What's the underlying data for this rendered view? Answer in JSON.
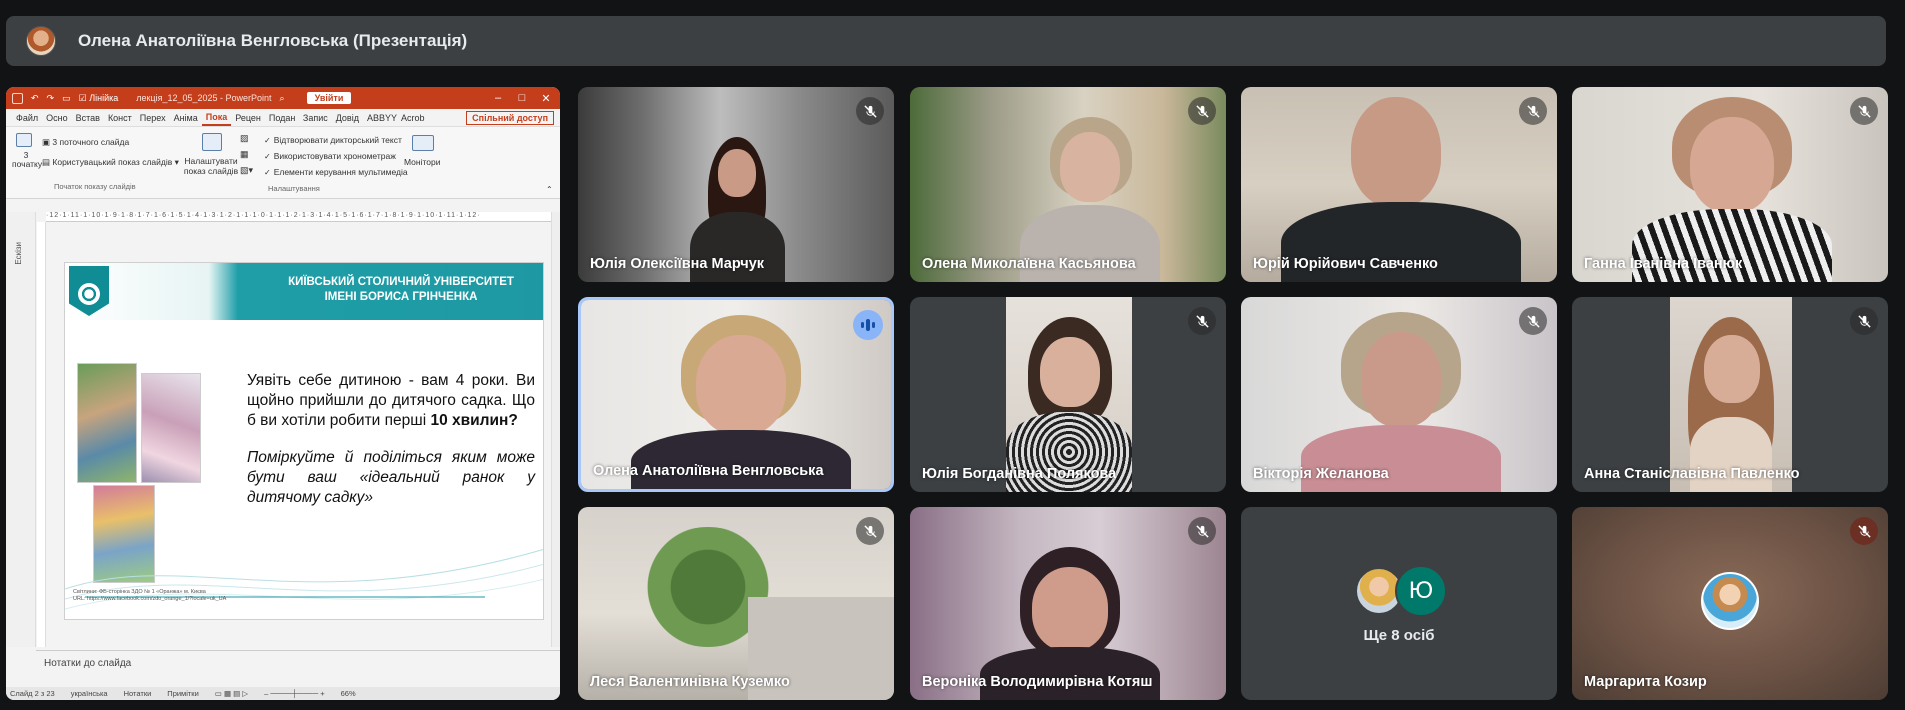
{
  "header": {
    "title": "Олена Анатоліївна Венгловська (Презентація)"
  },
  "ppt": {
    "ruler_label": "Лінійка",
    "doc_title": "лекція_12_05_2025  -  PowerPoint",
    "login": "Увійти",
    "tabs": [
      "Файл",
      "Осно",
      "Встав",
      "Конст",
      "Перех",
      "Аніма",
      "Пока",
      "Рецен",
      "Подан",
      "Запис",
      "Довід",
      "ABBYY",
      "Acrob"
    ],
    "active_tab": "Пока",
    "share": "Спільний доступ",
    "ribbon": {
      "from_start": "3 початку",
      "from_current": "3 поточного слайда",
      "custom_show": "Користувацький показ слайдів",
      "group1": "Початок показу слайдів",
      "setup": "Налаштувати показ слайдів",
      "opt1": "Відтворювати дикторський текст",
      "opt2": "Використовувати хронометраж",
      "opt3": "Елементи керування мультимедіа",
      "group2": "Налаштування",
      "monitors": "Монітори"
    },
    "left_pane": "Ескізи",
    "ruler_ticks": "·12·1·11·1·10·1·9·1·8·1·7·1·6·1·5·1·4·1·3·1·2·1·1·1·0·1·1·1·2·1·3·1·4·1·5·1·6·1·7·1·8·1·9·1·10·1·11·1·12·",
    "slide": {
      "university_line1": "КИЇВСЬКИЙ СТОЛИЧНИЙ УНІВЕРСИТЕТ",
      "university_line2": "ІМЕНІ БОРИСА ГРІНЧЕНКА",
      "text_a": "Уявіть себе дитиною - вам 4 роки. Ви щойно прийшли до дитячого садка. Що б ви хотіли робити перші ",
      "text_bold": "10 хвилин?",
      "text_italic": "Поміркуйте й поділіться яким може бути ваш «ідеальний ранок у дитячому садку»",
      "credit_line1": "Світлини: ФБ-сторінка ЗДО № 1 «Оранжа» м. Києва",
      "credit_line2": "URL: https://www.facebook.com/zdo_orange_1/?locale=uk_UA"
    },
    "notes": "Нотатки до слайда",
    "status": {
      "slide_of": "Слайд 2 з 23",
      "language": "українська",
      "notes_btn": "Нотатки",
      "comments_btn": "Примітки",
      "zoom": "66%"
    }
  },
  "participants": [
    {
      "name": "Юлія Олексіївна Марчук",
      "muted": true
    },
    {
      "name": "Олена Миколаївна Касьянова",
      "muted": true
    },
    {
      "name": "Юрій Юрійович Савченко",
      "muted": true
    },
    {
      "name": "Ганна Іванівна Іванюк",
      "muted": true
    },
    {
      "name": "Олена Анатоліївна Венгловська",
      "muted": false,
      "speaking": true
    },
    {
      "name": "Юлія Богданівна Полякова",
      "muted": true
    },
    {
      "name": "Вікторія Желанова",
      "muted": true
    },
    {
      "name": "Анна Станіславівна Павленко",
      "muted": true
    },
    {
      "name": "Леся Валентинівна Куземко",
      "muted": true
    },
    {
      "name": "Вероніка Володимирівна Котяш",
      "muted": true
    },
    {
      "name": "Маргарита Козир",
      "muted": true
    }
  ],
  "others": {
    "initial": "Ю",
    "label": "Ще 8 осіб"
  },
  "colors": {
    "meet_bg": "#121314",
    "tile_bg": "#3c4043",
    "ppt_accent": "#c43e1c",
    "speaking": "#a8c7fa",
    "uni_teal": "#1e99a3"
  }
}
